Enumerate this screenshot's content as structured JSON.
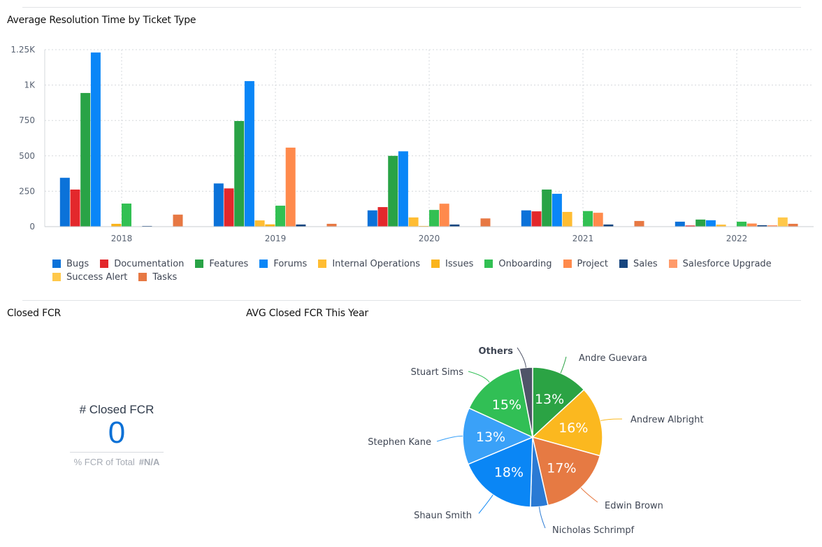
{
  "panels": {
    "bar_title": "Average Resolution Time by Ticket Type",
    "kpi_title": "Closed FCR",
    "pie_title": "AVG Closed FCR This Year"
  },
  "kpi": {
    "label": "# Closed FCR",
    "value": "0",
    "sub_label": "% FCR of Total",
    "sub_value": "#N/A",
    "value_color": "#0a70d6"
  },
  "chart_data": [
    {
      "type": "bar",
      "title": "Average Resolution Time by Ticket Type",
      "xlabel": "",
      "ylabel": "",
      "ylim": [
        0,
        1250
      ],
      "yticks": [
        0,
        250,
        500,
        750,
        1000,
        1250
      ],
      "ytick_labels": [
        "0",
        "250",
        "500",
        "750",
        "1K",
        "1.25K"
      ],
      "grid": true,
      "legend_position": "bottom",
      "categories": [
        "2018",
        "2019",
        "2020",
        "2021",
        "2022"
      ],
      "series": [
        {
          "name": "Bugs",
          "color": "#0b72d9",
          "values": [
            345,
            305,
            115,
            115,
            35
          ]
        },
        {
          "name": "Documentation",
          "color": "#e3282c",
          "values": [
            262,
            270,
            138,
            108,
            8
          ]
        },
        {
          "name": "Features",
          "color": "#29a346",
          "values": [
            944,
            746,
            500,
            262,
            50
          ]
        },
        {
          "name": "Forums",
          "color": "#0a86f7",
          "values": [
            1230,
            1028,
            532,
            232,
            45
          ]
        },
        {
          "name": "Internal Operations",
          "color": "#ffbd33",
          "values": [
            0,
            44,
            65,
            104,
            14
          ]
        },
        {
          "name": "Issues",
          "color": "#fab41c",
          "values": [
            20,
            16,
            5,
            0,
            0
          ]
        },
        {
          "name": "Onboarding",
          "color": "#32c053",
          "values": [
            163,
            148,
            118,
            110,
            35
          ]
        },
        {
          "name": "Project",
          "color": "#ff8a4c",
          "values": [
            0,
            558,
            162,
            98,
            22
          ]
        },
        {
          "name": "Sales",
          "color": "#17467f",
          "values": [
            5,
            15,
            15,
            15,
            10
          ]
        },
        {
          "name": "Salesforce Upgrade",
          "color": "#ff9a6a",
          "values": [
            0,
            0,
            0,
            0,
            10
          ]
        },
        {
          "name": "Success Alert",
          "color": "#ffc84a",
          "values": [
            0,
            0,
            0,
            0,
            65
          ]
        },
        {
          "name": "Tasks",
          "color": "#e77843",
          "values": [
            85,
            20,
            58,
            40,
            20
          ]
        }
      ]
    },
    {
      "type": "pie",
      "title": "AVG Closed FCR This Year",
      "slices": [
        {
          "name": "Andre Guevara",
          "value": 13,
          "label": "13%",
          "color": "#2ba344",
          "bold": false
        },
        {
          "name": "Andrew Albright",
          "value": 16,
          "label": "16%",
          "color": "#fbb81f",
          "bold": false
        },
        {
          "name": "Edwin Brown",
          "value": 17,
          "label": "17%",
          "color": "#e67a43",
          "bold": false
        },
        {
          "name": "Nicholas Schrimpf",
          "value": 4,
          "label": "",
          "color": "#2a7ad4",
          "bold": false
        },
        {
          "name": "Shaun Smith",
          "value": 18,
          "label": "18%",
          "color": "#0a86f5",
          "bold": false
        },
        {
          "name": "Stephen Kane",
          "value": 13,
          "label": "13%",
          "color": "#3aa1f8",
          "bold": false
        },
        {
          "name": "Stuart Sims",
          "value": 15,
          "label": "15%",
          "color": "#31bf55",
          "bold": false
        },
        {
          "name": "Others",
          "value": 3,
          "label": "",
          "color": "#4f5468",
          "bold": true
        }
      ]
    }
  ]
}
